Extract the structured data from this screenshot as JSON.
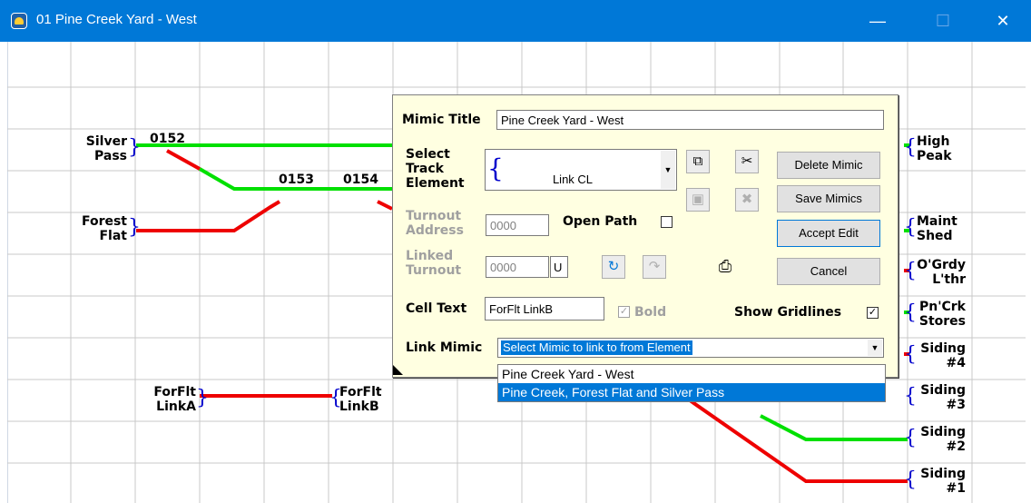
{
  "window": {
    "title": "01 Pine Creek Yard - West",
    "minimize": "—",
    "maximize": "☐",
    "close": "✕"
  },
  "mimic": {
    "cells": {
      "silver_pass": [
        "Silver",
        "Pass"
      ],
      "forest_flat": [
        "Forest",
        "Flat"
      ],
      "forflt_linka": [
        "ForFlt",
        "LinkA"
      ],
      "forflt_linkb": [
        "ForFlt",
        "LinkB"
      ],
      "high_peak": [
        "High",
        "Peak"
      ],
      "maint_shed": [
        "Maint",
        "Shed"
      ],
      "ogrdy_lthr": [
        "O'Grdy",
        "L'thr"
      ],
      "pncrk_stores": [
        "Pn'Crk",
        "Stores"
      ],
      "siding4": [
        "Siding",
        "#4"
      ],
      "siding3": [
        "Siding",
        "#3"
      ],
      "siding2": [
        "Siding",
        "#2"
      ],
      "siding1": [
        "Siding",
        "#1"
      ]
    },
    "turnouts": {
      "t0152": "0152",
      "t0153": "0153",
      "t0154": "0154"
    },
    "colors": {
      "green": "#00e000",
      "red": "#ee0000",
      "grid": "#c8c8c8"
    }
  },
  "dialog": {
    "mimic_title_label": "Mimic Title",
    "mimic_title_value": "Pine Creek Yard - West",
    "select_track_label": [
      "Select",
      "Track",
      "Element"
    ],
    "track_element_value": "Link CL",
    "turnout_address_label": [
      "Turnout",
      "Address"
    ],
    "turnout_address_value": "0000",
    "open_path_label": "Open Path",
    "linked_turnout_label": [
      "Linked",
      "Turnout"
    ],
    "linked_turnout_value": "0000",
    "linked_turnout_suffix": "U",
    "cell_text_label": "Cell Text",
    "cell_text_value": "ForFlt LinkB",
    "bold_label": "Bold",
    "show_gridlines_label": "Show Gridlines",
    "link_mimic_label": "Link Mimic",
    "link_mimic_value": "Select Mimic to link to from Element",
    "link_mimic_options": [
      "Pine Creek Yard - West",
      "Pine Creek, Forest Flat and Silver Pass"
    ],
    "buttons": {
      "delete": "Delete Mimic",
      "save": "Save Mimics",
      "accept": "Accept Edit",
      "cancel": "Cancel"
    },
    "icons": {
      "copy": "copy-icon",
      "cut": "cut-icon",
      "paste": "paste-icon",
      "delete_element": "delete-element-icon",
      "rotate": "rotate-icon",
      "redo": "redo-icon",
      "print": "printer-icon"
    },
    "checkbox_mark": "✓",
    "bold_checked": true,
    "gridlines_checked": true,
    "open_path_checked": false
  }
}
